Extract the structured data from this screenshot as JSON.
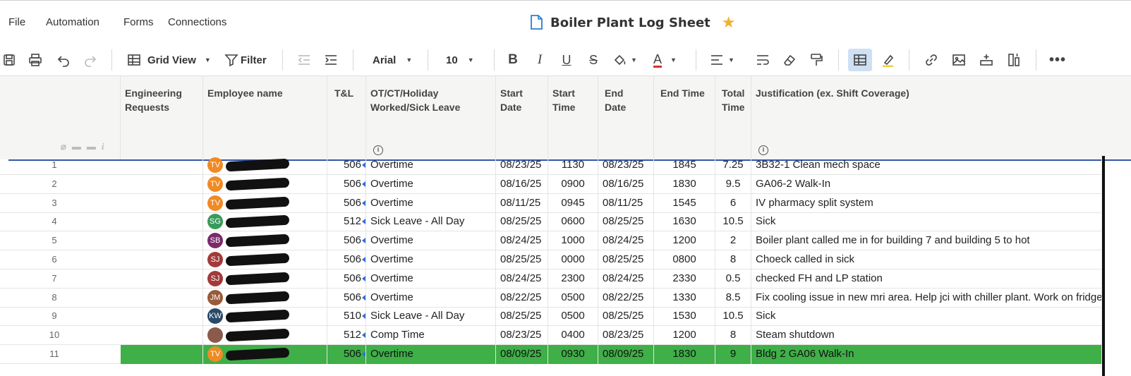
{
  "menu": [
    "File",
    "Automation",
    "Forms",
    "Connections"
  ],
  "title": "Boiler Plant Log Sheet",
  "toolbar": {
    "view_label": "Grid View",
    "filter_label": "Filter",
    "font": "Arial",
    "font_size": "10"
  },
  "columns": {
    "engineering_requests": "Engineering Requests",
    "employee_name": "Employee name",
    "tl": "T&L",
    "ot_type": "OT/CT/Holiday Worked/Sick Leave",
    "start_date": "Start Date",
    "start_time": "Start Time",
    "end_date": "End Date",
    "end_time": "End Time",
    "total_time": "Total Time",
    "justification": "Justification (ex. Shift Coverage)"
  },
  "rows": [
    {
      "num": "1",
      "initials": "TV",
      "avatar_color": "#f08a24",
      "tl": "506",
      "type": "Overtime",
      "start_date": "08/23/25",
      "start_time": "1130",
      "end_date": "08/23/25",
      "end_time": "1845",
      "total": "7.25",
      "justification": "3B32-1 Clean mech space"
    },
    {
      "num": "2",
      "initials": "TV",
      "avatar_color": "#f08a24",
      "tl": "506",
      "type": "Overtime",
      "start_date": "08/16/25",
      "start_time": "0900",
      "end_date": "08/16/25",
      "end_time": "1830",
      "total": "9.5",
      "justification": "GA06-2 Walk-In"
    },
    {
      "num": "3",
      "initials": "TV",
      "avatar_color": "#f08a24",
      "tl": "506",
      "type": "Overtime",
      "start_date": "08/11/25",
      "start_time": "0945",
      "end_date": "08/11/25",
      "end_time": "1545",
      "total": "6",
      "justification": "IV pharmacy split system"
    },
    {
      "num": "4",
      "initials": "SG",
      "avatar_color": "#3a9a5b",
      "tl": "512",
      "type": "Sick Leave - All Day",
      "start_date": "08/25/25",
      "start_time": "0600",
      "end_date": "08/25/25",
      "end_time": "1630",
      "total": "10.5",
      "justification": "Sick"
    },
    {
      "num": "5",
      "initials": "SB",
      "avatar_color": "#7a2a6a",
      "tl": "506",
      "type": "Overtime",
      "start_date": "08/24/25",
      "start_time": "1000",
      "end_date": "08/24/25",
      "end_time": "1200",
      "total": "2",
      "justification": "Boiler plant called me in for building 7 and building 5 to hot"
    },
    {
      "num": "6",
      "initials": "SJ",
      "avatar_color": "#a23a3a",
      "tl": "506",
      "type": "Overtime",
      "start_date": "08/25/25",
      "start_time": "0000",
      "end_date": "08/25/25",
      "end_time": "0800",
      "total": "8",
      "justification": "Choeck called in sick"
    },
    {
      "num": "7",
      "initials": "SJ",
      "avatar_color": "#a23a3a",
      "tl": "506",
      "type": "Overtime",
      "start_date": "08/24/25",
      "start_time": "2300",
      "end_date": "08/24/25",
      "end_time": "2330",
      "total": "0.5",
      "justification": "checked FH and LP station"
    },
    {
      "num": "8",
      "initials": "JM",
      "avatar_color": "#9a5a3a",
      "tl": "506",
      "type": "Overtime",
      "start_date": "08/22/25",
      "start_time": "0500",
      "end_date": "08/22/25",
      "end_time": "1330",
      "total": "8.5",
      "justification": "Fix cooling issue in new mri area. Help jci with chiller plant. Work on fridge in"
    },
    {
      "num": "9",
      "initials": "KW",
      "avatar_color": "#2a4a6a",
      "tl": "510",
      "type": "Sick Leave - All Day",
      "start_date": "08/25/25",
      "start_time": "0500",
      "end_date": "08/25/25",
      "end_time": "1530",
      "total": "10.5",
      "justification": "Sick"
    },
    {
      "num": "10",
      "initials": "",
      "avatar_color": "#8a5a4a",
      "tl": "512",
      "type": "Comp Time",
      "start_date": "08/23/25",
      "start_time": "0400",
      "end_date": "08/23/25",
      "end_time": "1200",
      "total": "8",
      "justification": "Steam shutdown"
    },
    {
      "num": "11",
      "initials": "TV",
      "avatar_color": "#f08a24",
      "tl": "506",
      "type": "Overtime",
      "start_date": "08/09/25",
      "start_time": "0930",
      "end_date": "08/09/25",
      "end_time": "1830",
      "total": "9",
      "justification": "Bldg 2 GA06 Walk-In",
      "highlight_color": "#3faf48"
    }
  ]
}
